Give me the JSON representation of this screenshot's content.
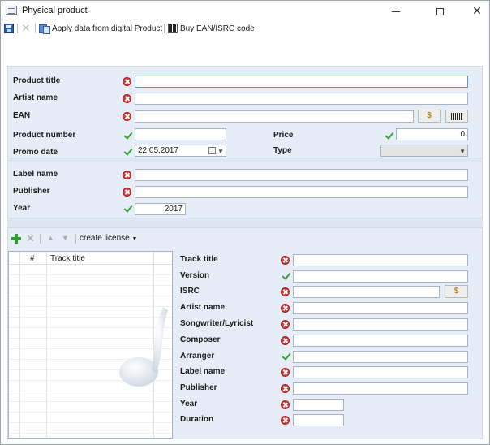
{
  "window": {
    "title": "Physical product"
  },
  "toolbar": {
    "apply_label": "Apply data from digital Product",
    "buy_label": "Buy EAN/ISRC code"
  },
  "product": {
    "product_title_label": "Product title",
    "artist_name_label": "Artist name",
    "ean_label": "EAN",
    "ean_buy_button": "$",
    "product_number_label": "Product number",
    "price_label": "Price",
    "price_value": "0",
    "promo_date_label": "Promo date",
    "promo_date_value": "22.05.2017",
    "type_label": "Type",
    "type_value": ""
  },
  "label_group": {
    "label_name_label": "Label name",
    "publisher_label": "Publisher",
    "year_label": "Year",
    "year_value": "2017"
  },
  "tracks": {
    "create_license_label": "create license",
    "columns": [
      "#",
      "Track title"
    ],
    "rows": []
  },
  "track_form": {
    "track_title_label": "Track title",
    "version_label": "Version",
    "isrc_label": "ISRC",
    "isrc_buy_button": "$",
    "artist_name_label": "Artist name",
    "songwriter_label": "Songwriter/Lyricist",
    "composer_label": "Composer",
    "arranger_label": "Arranger",
    "label_name_label": "Label name",
    "publisher_label": "Publisher",
    "year_label": "Year",
    "duration_label": "Duration"
  },
  "colors": {
    "panel": "#e6edf6",
    "error": "#d43a3a",
    "ok": "#3aa232",
    "accent": "#2f5ea8"
  }
}
